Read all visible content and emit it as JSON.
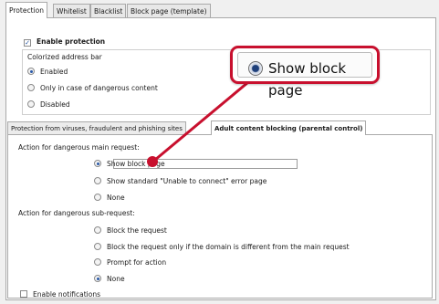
{
  "tabs": [
    {
      "label": "Protection",
      "active": true
    },
    {
      "label": "Whitelist",
      "active": false
    },
    {
      "label": "Blacklist",
      "active": false
    },
    {
      "label": "Block page (template)",
      "active": false
    }
  ],
  "enable_protection": {
    "label": "Enable protection",
    "checked": true
  },
  "address_bar": {
    "title": "Colorized address bar",
    "options": [
      {
        "label": "Enabled",
        "selected": true
      },
      {
        "label": "Only in case of dangerous content",
        "selected": false
      },
      {
        "label": "Disabled",
        "selected": false
      }
    ]
  },
  "subtabs": [
    {
      "label": "Protection from viruses, fraudulent and phishing sites",
      "active": false
    },
    {
      "label": "Adult content blocking (parental control)",
      "active": true
    }
  ],
  "main_request": {
    "title": "Action for dangerous main request:",
    "options": [
      {
        "label": "Show block page",
        "selected": true
      },
      {
        "label": "Show standard \"Unable to connect\" error page",
        "selected": false
      },
      {
        "label": "None",
        "selected": false
      }
    ]
  },
  "sub_request": {
    "title": "Action for dangerous sub-request:",
    "options": [
      {
        "label": "Block the request",
        "selected": false
      },
      {
        "label": "Block the request only if the domain is different from the main request",
        "selected": false
      },
      {
        "label": "Prompt for action",
        "selected": false
      },
      {
        "label": "None",
        "selected": true
      }
    ]
  },
  "enable_notifications": {
    "label": "Enable notifications",
    "checked": false
  },
  "callout": {
    "label": "Show block page"
  },
  "colors": {
    "callout_red": "#c8102e",
    "radio_blue": "#2a5aa8"
  }
}
